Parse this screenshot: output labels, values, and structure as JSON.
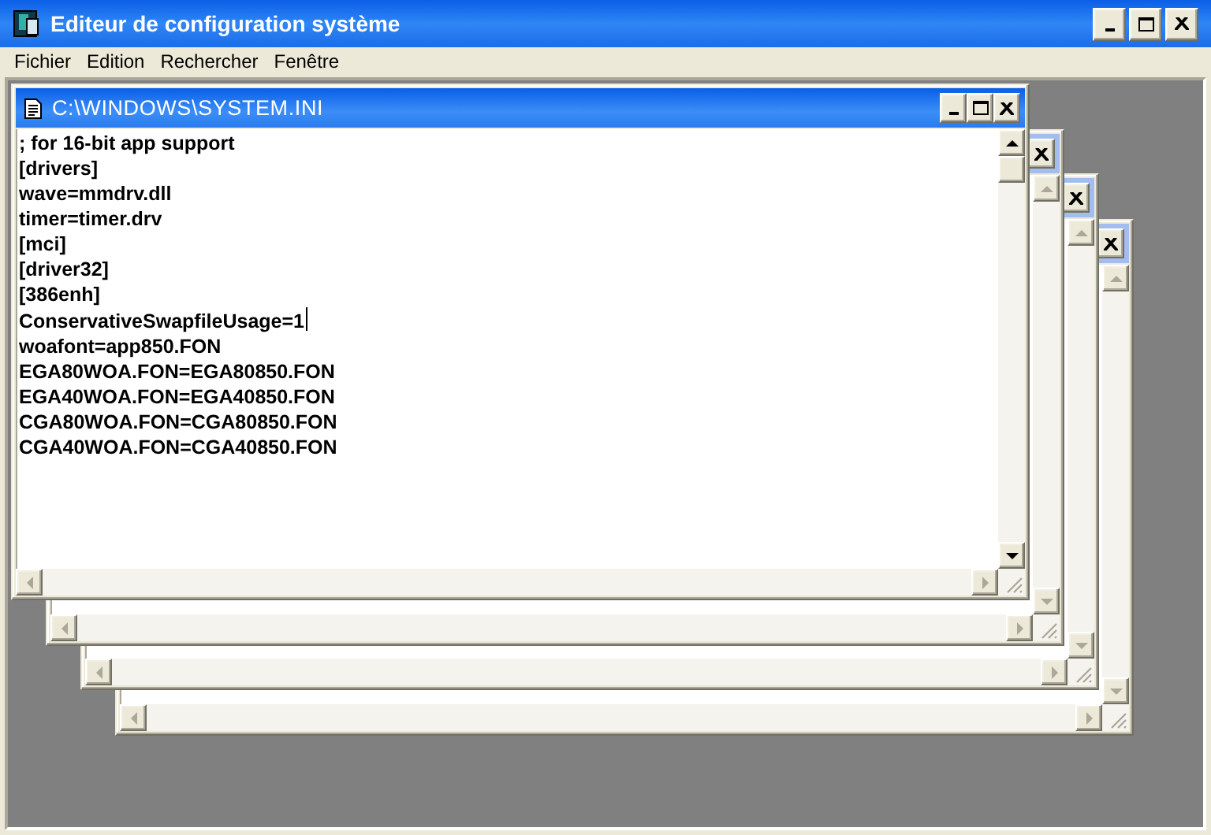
{
  "window": {
    "title": "Editeur de configuration système"
  },
  "menu": [
    "Fichier",
    "Edition",
    "Rechercher",
    "Fenêtre"
  ],
  "documents": [
    {
      "title": "C:\\WINDOWS\\SYSTEM.INI",
      "active": true,
      "lines": [
        {
          "text": "; for 16-bit app support",
          "caret": false
        },
        {
          "text": "[drivers]",
          "caret": false
        },
        {
          "text": "wave=mmdrv.dll",
          "caret": false
        },
        {
          "text": "timer=timer.drv",
          "caret": false
        },
        {
          "text": "[mci]",
          "caret": false
        },
        {
          "text": "[driver32]",
          "caret": false
        },
        {
          "text": "[386enh]",
          "caret": false
        },
        {
          "text": "ConservativeSwapfileUsage=1",
          "caret": true
        },
        {
          "text": "woafont=app850.FON",
          "caret": false
        },
        {
          "text": "EGA80WOA.FON=EGA80850.FON",
          "caret": false
        },
        {
          "text": "EGA40WOA.FON=EGA40850.FON",
          "caret": false
        },
        {
          "text": "CGA80WOA.FON=CGA80850.FON",
          "caret": false
        },
        {
          "text": "CGA40WOA.FON=CGA40850.FON",
          "caret": false
        }
      ]
    },
    {
      "active": false
    },
    {
      "active": false
    },
    {
      "active": false
    }
  ]
}
